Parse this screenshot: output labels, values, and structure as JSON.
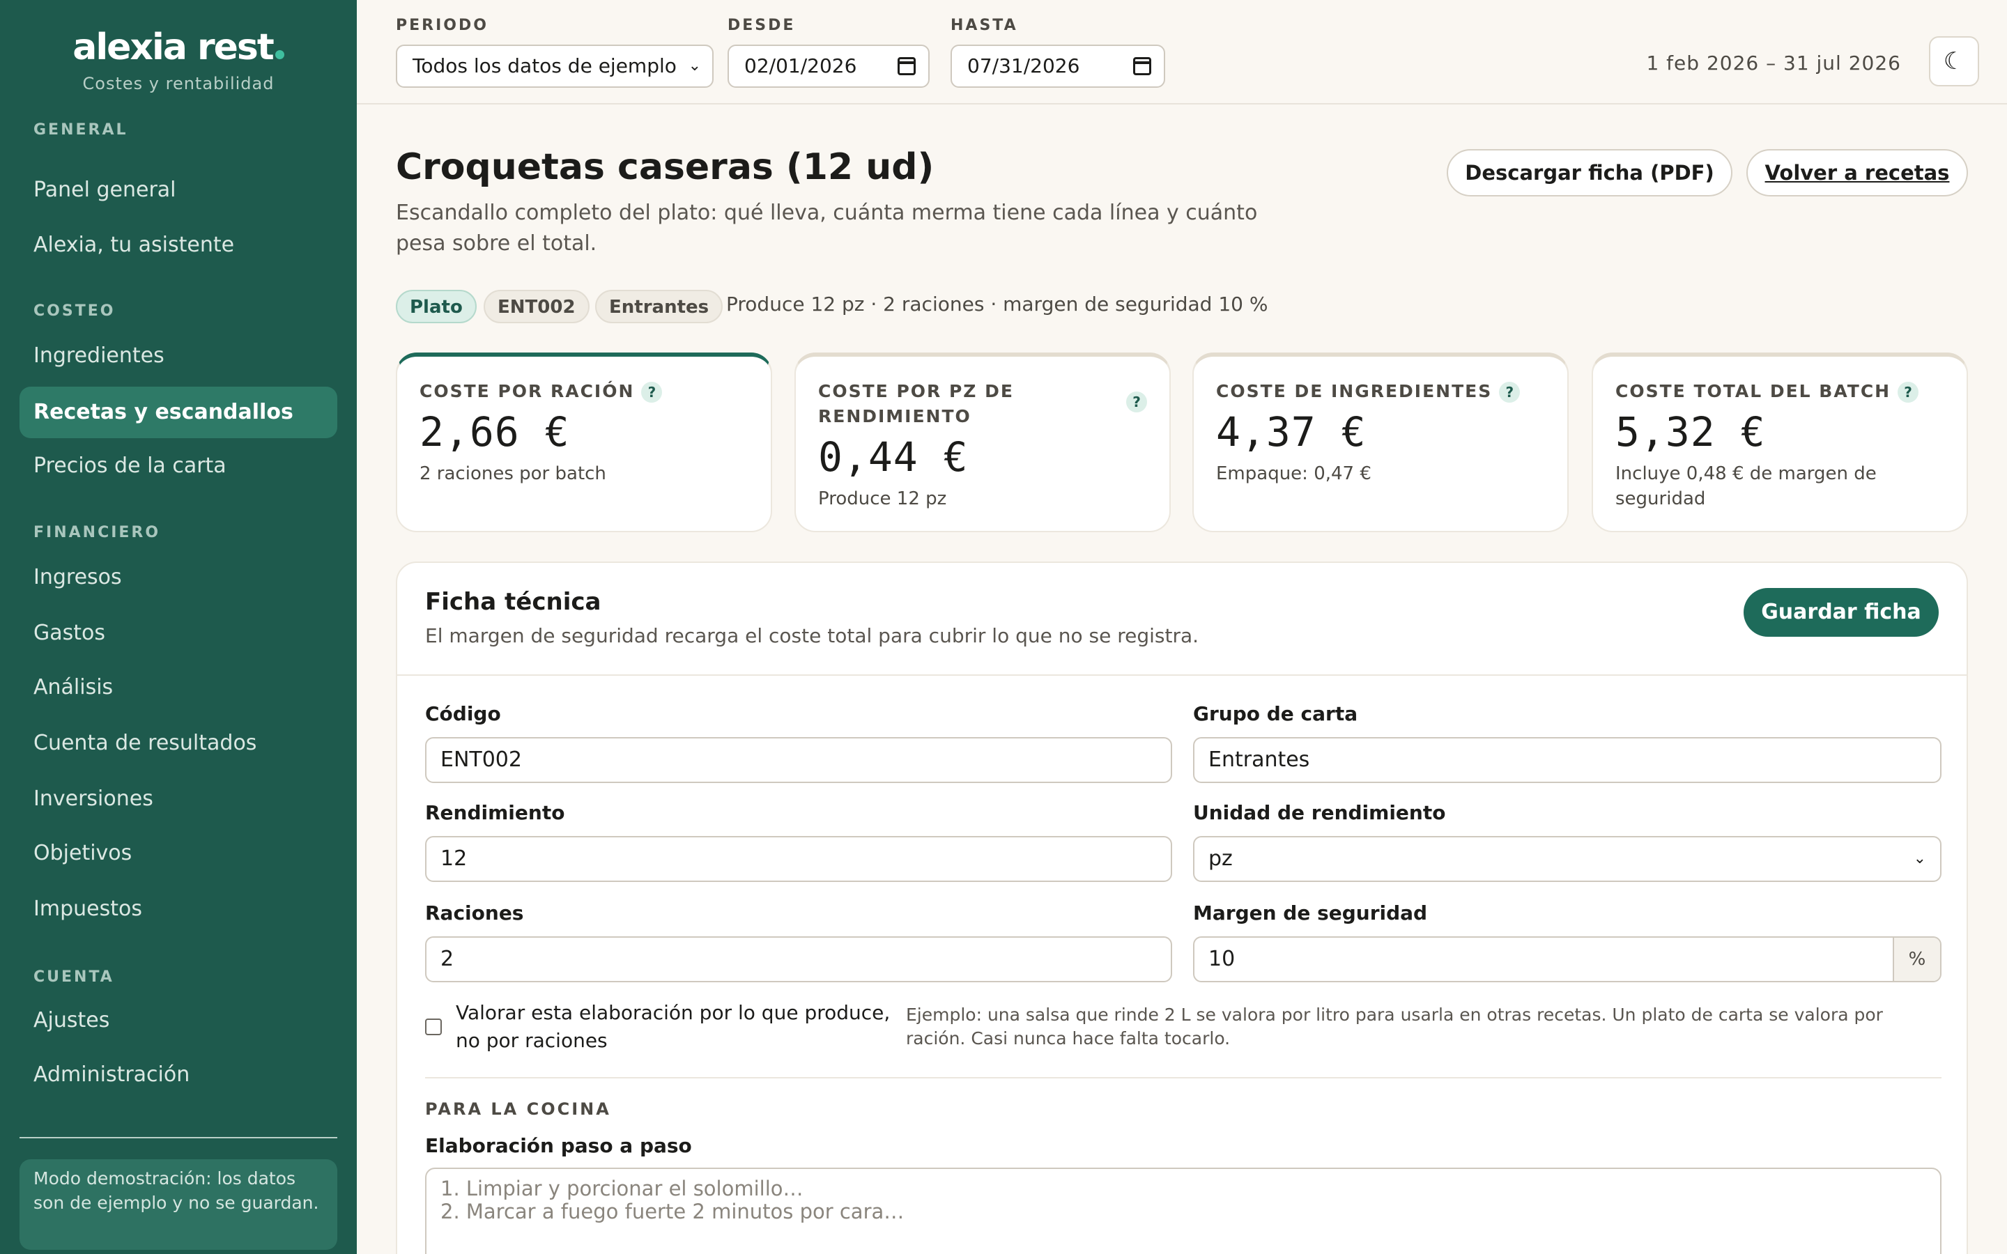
{
  "brand": {
    "name": "alexia rest",
    "tagline": "Costes y rentabilidad"
  },
  "sidebar": {
    "sections": [
      {
        "label": "GENERAL",
        "items": [
          "Panel general",
          "Alexia, tu asistente"
        ]
      },
      {
        "label": "COSTEO",
        "items": [
          "Ingredientes",
          "Recetas y escandallos",
          "Precios de la carta"
        ]
      },
      {
        "label": "FINANCIERO",
        "items": [
          "Ingresos",
          "Gastos",
          "Análisis",
          "Cuenta de resultados",
          "Inversiones",
          "Objetivos",
          "Impuestos"
        ]
      },
      {
        "label": "CUENTA",
        "items": [
          "Ajustes",
          "Administración"
        ]
      }
    ],
    "active_item": "Recetas y escandallos",
    "demo_notice": "Modo demostración: los datos son de ejemplo y no se guardan."
  },
  "topbar": {
    "periodo_label": "PERIODO",
    "periodo_value": "Todos los datos de ejemplo",
    "desde_label": "DESDE",
    "desde_value": "02/01/2026",
    "hasta_label": "HASTA",
    "hasta_value": "07/31/2026",
    "range_text": "1 feb 2026 – 31 jul 2026",
    "theme_icon": "moon-icon"
  },
  "header": {
    "title": "Croquetas caseras (12 ud)",
    "description": "Escandallo completo del plato: qué lleva, cuánta merma tiene cada línea y cuánto pesa sobre el total.",
    "download_button": "Descargar ficha (PDF)",
    "back_button": "Volver a recetas",
    "chips": [
      "Plato",
      "ENT002",
      "Entrantes"
    ],
    "meta": "Produce 12 pz · 2 raciones · margen de seguridad 10 %"
  },
  "kpis": [
    {
      "label": "COSTE POR RACIÓN",
      "value": "2,66 €",
      "note": "2 raciones por batch"
    },
    {
      "label": "COSTE POR PZ DE RENDIMIENTO",
      "value": "0,44 €",
      "note": "Produce 12 pz"
    },
    {
      "label": "COSTE DE INGREDIENTES",
      "value": "4,37 €",
      "note": "Empaque: 0,47 €"
    },
    {
      "label": "COSTE TOTAL DEL BATCH",
      "value": "5,32 €",
      "note": "Incluye 0,48 € de margen de seguridad"
    }
  ],
  "help_glyph": "?",
  "form": {
    "title": "Ficha técnica",
    "subtitle": "El margen de seguridad recarga el coste total para cubrir lo que no se registra.",
    "save_button": "Guardar ficha",
    "codigo_label": "Código",
    "codigo_value": "ENT002",
    "grupo_label": "Grupo de carta",
    "grupo_value": "Entrantes",
    "rendimiento_label": "Rendimiento",
    "rendimiento_value": "12",
    "unidad_label": "Unidad de rendimiento",
    "unidad_value": "pz",
    "raciones_label": "Raciones",
    "raciones_value": "2",
    "margen_label": "Margen de seguridad",
    "margen_value": "10",
    "margen_suffix": "%",
    "checkbox_label": "Valorar esta elaboración por lo que produce, no por raciones",
    "checkbox_checked": false,
    "checkbox_hint": "Ejemplo: una salsa que rinde 2 L se valora por litro para usarla en otras recetas. Un plato de carta se valora por ración. Casi nunca hace falta tocarlo.",
    "kitchen_section": "PARA LA COCINA",
    "steps_label": "Elaboración paso a paso",
    "steps_placeholder": "1. Limpiar y porcionar el solomillo…\n2. Marcar a fuego fuerte 2 minutos por cara…"
  },
  "colors": {
    "sidebar": "#1e5a4d",
    "accent": "#1e6b5a",
    "background": "#faf7f2"
  }
}
